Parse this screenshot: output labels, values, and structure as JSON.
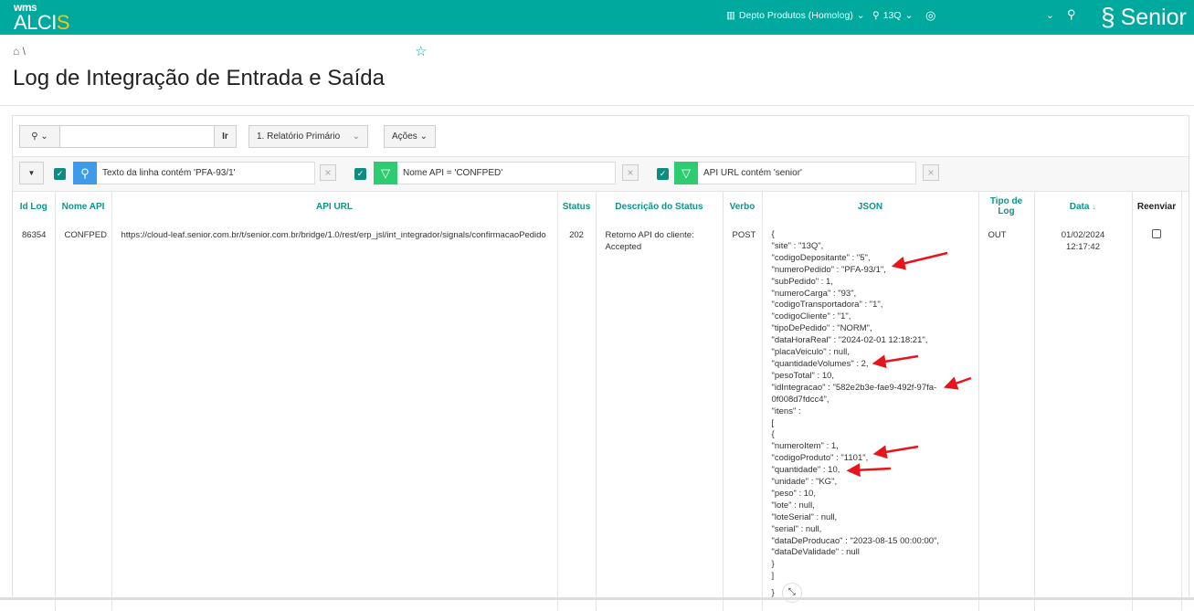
{
  "header": {
    "logo_top": "wms",
    "logo_main": "ALCI",
    "logo_accent": "S",
    "department": "Depto Produtos (Homolog)",
    "site": "13Q",
    "brand": "Senior"
  },
  "breadcrumb": {
    "separator": "\\"
  },
  "page": {
    "title": "Log de Integração de Entrada e Saída"
  },
  "toolbar": {
    "search_value": "",
    "go_label": "Ir",
    "report_select": "1. Relatório Primário",
    "actions_label": "Ações"
  },
  "filters": [
    {
      "text": "Texto da linha contém 'PFA-93/1'",
      "type": "search",
      "color": "#3d9be9"
    },
    {
      "text": "Nome API = 'CONFPED'",
      "type": "filter",
      "color": "#2ecc71"
    },
    {
      "text": "API URL contém 'senior'",
      "type": "filter",
      "color": "#2ecc71"
    }
  ],
  "table": {
    "columns": [
      "Id Log",
      "Nome API",
      "API URL",
      "Status",
      "Descrição do Status",
      "Verbo",
      "JSON",
      "Tipo de Log",
      "Data",
      "Reenviar"
    ],
    "rows": [
      {
        "id": "86354",
        "api": "CONFPED",
        "url": "https://cloud-leaf.senior.com.br/t/senior.com.br/bridge/1.0/rest/erp_jsl/int_integrador/signals/confirmacaoPedido",
        "status": "202",
        "desc": "Retorno API do cliente: Accepted",
        "verb": "POST",
        "tipo": "OUT",
        "data": "01/02/2024 12:17:42"
      }
    ],
    "json_lines": [
      "{",
      "\"site\" : \"13Q\",",
      "\"codigoDepositante\" : \"5\",",
      "\"numeroPedido\" : \"PFA-93/1\",",
      "\"subPedido\" : 1,",
      "\"numeroCarga\" : \"93\",",
      "\"codigoTransportadora\" : \"1\",",
      "\"codigoCliente\" : \"1\",",
      "\"tipoDePedido\" : \"NORM\",",
      "\"dataHoraReal\" : \"2024-02-01 12:18:21\",",
      "\"placaVeiculo\" : null,",
      "\"quantidadeVolumes\" : 2,",
      "\"pesoTotal\" : 10,",
      "\"idIntegracao\" : \"582e2b3e-fae9-492f-97fa-",
      "0f008d7fdcc4\",",
      "\"itens\" :",
      "[",
      "{",
      "\"numeroItem\" : 1,",
      "\"codigoProduto\" : \"1101\",",
      "\"quantidade\" : 10,",
      "\"unidade\" : \"KG\",",
      "\"peso\" : 10,",
      "\"lote\" : null,",
      "\"loteSerial\" : null,",
      "\"serial\" : null,",
      "\"dataDeProducao\" : \"2023-08-15 00:00:00\",",
      "\"dataDeValidade\" : null",
      "}",
      "]",
      "}"
    ]
  }
}
